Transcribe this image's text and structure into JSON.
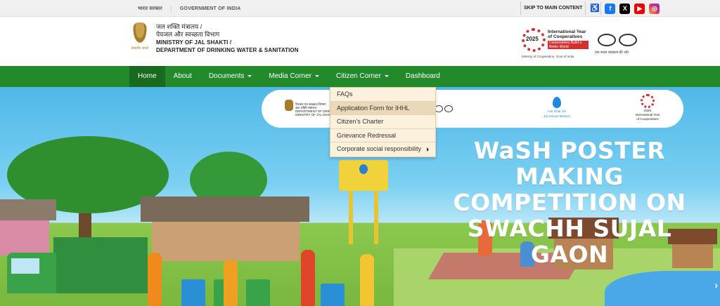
{
  "govbar": {
    "hindi": "भारत सरकार",
    "english": "GOVERNMENT OF INDIA",
    "skip": "SKIP TO MAIN CONTENT",
    "social": [
      "f",
      "X",
      "▶",
      "◎"
    ]
  },
  "header": {
    "emblem_motto": "सत्यमेव जयते",
    "ministry_hi_1": "जल शक्ति मंत्रालय /",
    "ministry_hi_2": "पेयजल और स्वच्छता विभाग",
    "ministry_en_1": "MINISTRY OF JAL SHAKTI /",
    "ministry_en_2": "DEPARTMENT OF DRINKING WATER & SANITATION",
    "iyc_year": "2025",
    "iyc_title": "International Year of Cooperatives",
    "iyc_tag": "Cooperatives Build a Better World",
    "iyc_caption": "Ministry of Cooperation, Govt of India",
    "swachh_caption": "एक कदम स्वच्छता की ओर"
  },
  "nav": {
    "items": [
      {
        "label": "Home",
        "caret": false
      },
      {
        "label": "About",
        "caret": false
      },
      {
        "label": "Documents",
        "caret": true
      },
      {
        "label": "Media Corner",
        "caret": true
      },
      {
        "label": "Citizen Corner",
        "caret": true
      },
      {
        "label": "Dashboard",
        "caret": false
      }
    ]
  },
  "dropdown": {
    "items": [
      {
        "label": "FAQs",
        "sub": false
      },
      {
        "label": "Application Form for IHHL",
        "sub": false
      },
      {
        "label": "Citizen's Charter",
        "sub": false
      },
      {
        "label": "Grievance Redressal",
        "sub": false
      },
      {
        "label": "Corporate social responsibility",
        "sub": true
      }
    ]
  },
  "banner": {
    "headline_1": "WaSH POSTER MAKING",
    "headline_2": "COMPETITION ON",
    "headline_3": "SWACHH SUJAL GAON",
    "strip_ministry_1": "पेयजल एवं स्वच्छता विभाग",
    "strip_ministry_2": "जल शक्ति मंत्रालय",
    "strip_ministry_3": "DEPARTMENT OF DRINKING",
    "strip_ministry_4": "MINISTRY OF JAL SHAKTI",
    "strip_hgj_1": "Har Ghar Jal",
    "strip_hgj_2": "Jal Jeevan Mission",
    "strip_iyc_year": "2025",
    "strip_iyc_1": "International Year",
    "strip_iyc_2": "of Cooperatives",
    "next": "›"
  }
}
